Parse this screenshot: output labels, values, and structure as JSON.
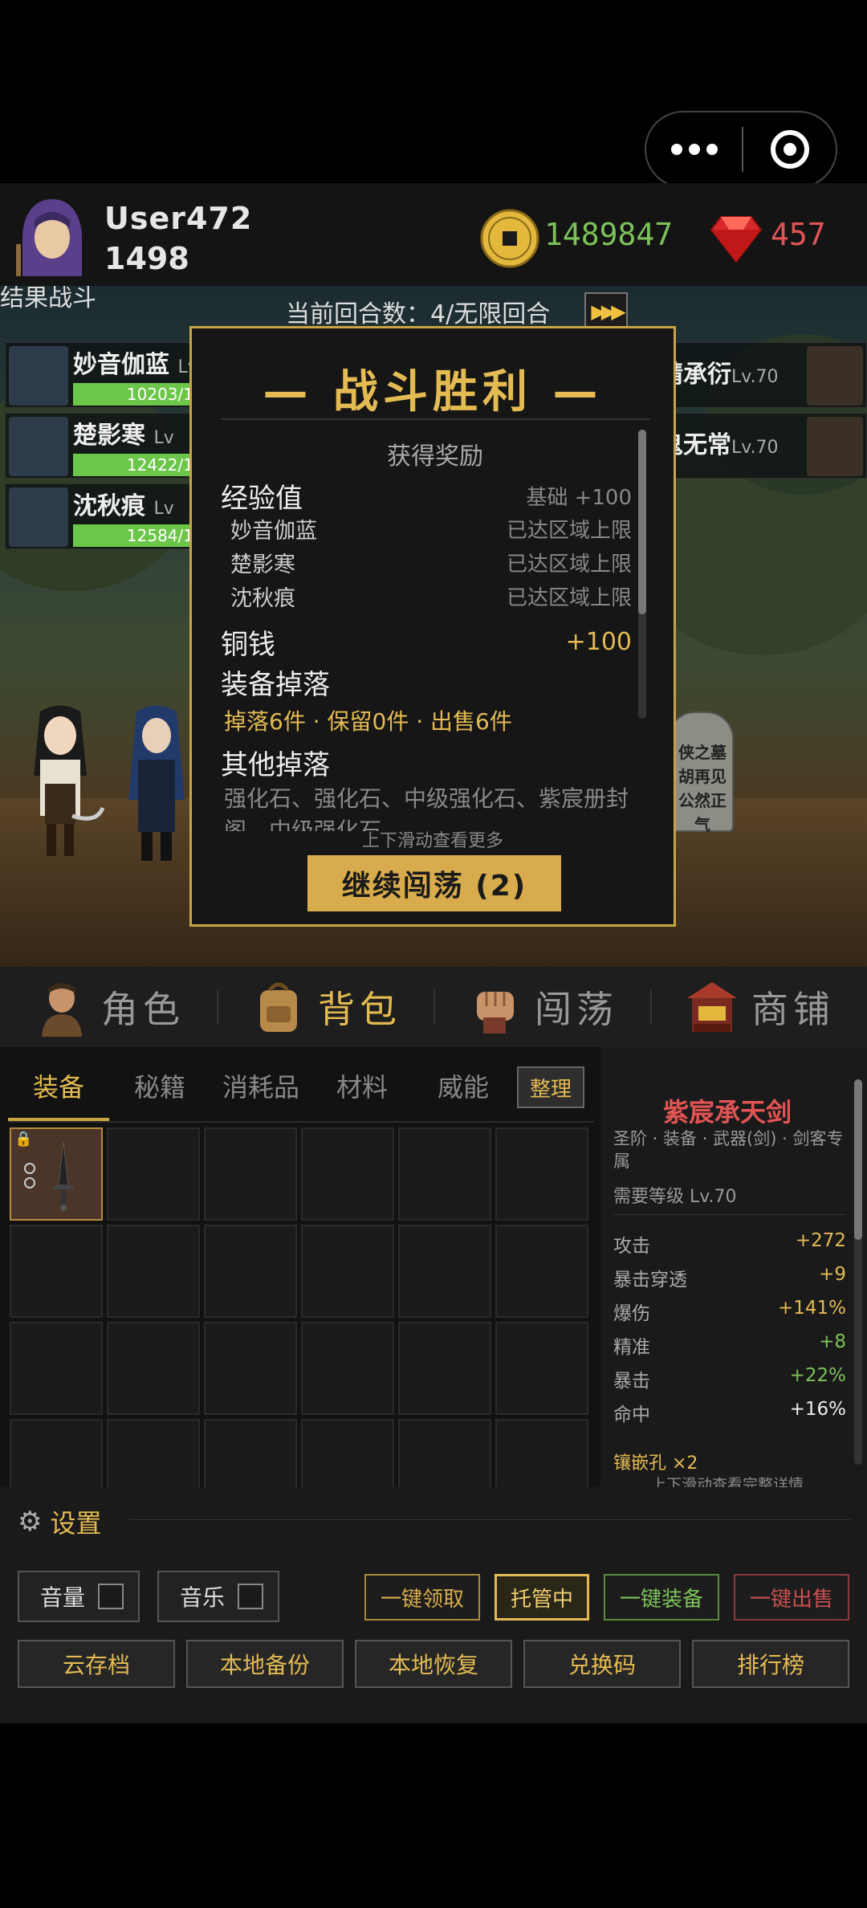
{
  "colors": {
    "gold": "#e4bb52",
    "green": "#7cc25a",
    "red": "#e15454",
    "panel": "#161616"
  },
  "capsule": {
    "more_icon": "more-dots-icon",
    "close_icon": "close-target-icon"
  },
  "header": {
    "username": "User472",
    "level": "1498",
    "coins": "1489847",
    "gems": "457"
  },
  "battle": {
    "clipped_label": "结果战斗",
    "round_text": "当前回合数：4/无限回合",
    "heroes": [
      {
        "name": "妙音伽蓝",
        "lv": "Lv",
        "hp": "10203/1"
      },
      {
        "name": "楚影寒",
        "lv": "Lv",
        "hp": "12422/1"
      },
      {
        "name": "沈秋痕",
        "lv": "Lv",
        "hp": "12584/1"
      }
    ],
    "enemies": [
      {
        "name": "靖承衍",
        "lv": "Lv.70"
      },
      {
        "name": "鬼无常",
        "lv": "Lv.70"
      }
    ],
    "tomb_text": "侠之墓 胡再见 公然正气"
  },
  "modal": {
    "title": "— 战斗胜利 —",
    "rewards_head": "获得奖励",
    "exp_label": "经验值",
    "exp_value": "基础 +100",
    "exp_rows": [
      {
        "name": "妙音伽蓝",
        "status": "已达区域上限"
      },
      {
        "name": "楚影寒",
        "status": "已达区域上限"
      },
      {
        "name": "沈秋痕",
        "status": "已达区域上限"
      }
    ],
    "copper_label": "铜钱",
    "copper_value": "+100",
    "equip_label": "装备掉落",
    "equip_line": "掉落6件 · 保留0件 · 出售6件",
    "other_label": "其他掉落",
    "other_line": "强化石、强化石、中级强化石、紫宸册封",
    "other_line2": "阁、中级强化石",
    "hint": "上下滑动查看更多",
    "continue": "继续闯荡 (2)"
  },
  "nav": [
    {
      "label": "角色",
      "icon": "character-icon"
    },
    {
      "label": "背包",
      "icon": "backpack-icon"
    },
    {
      "label": "闯荡",
      "icon": "fist-icon"
    },
    {
      "label": "商铺",
      "icon": "shop-icon"
    }
  ],
  "inventory": {
    "tabs": [
      "装备",
      "秘籍",
      "消耗品",
      "材料",
      "威能"
    ],
    "sort": "整理"
  },
  "item": {
    "name": "紫宸承天剑",
    "tags": "圣阶 · 装备 · 武器(剑) · 剑客专属",
    "req": "需要等级 Lv.70",
    "stats": [
      {
        "label": "攻击",
        "value": "+272"
      },
      {
        "label": "暴击穿透",
        "value": "+9"
      },
      {
        "label": "爆伤",
        "value": "+141%"
      },
      {
        "label": "精准",
        "value": "+8"
      },
      {
        "label": "暴击",
        "value": "+22%"
      },
      {
        "label": "命中",
        "value": "+16%"
      }
    ],
    "socket": "镶嵌孔 ×2",
    "hint": "上下滑动查看完整详情"
  },
  "settings": {
    "title": "设置",
    "volume": "音量",
    "music": "音乐",
    "collect_all": "一键领取",
    "auto": "托管中",
    "equip_all": "一键装备",
    "sell_all": "一键出售",
    "cloud_save": "云存档",
    "local_backup": "本地备份",
    "local_restore": "本地恢复",
    "redeem": "兑换码",
    "rank": "排行榜"
  }
}
